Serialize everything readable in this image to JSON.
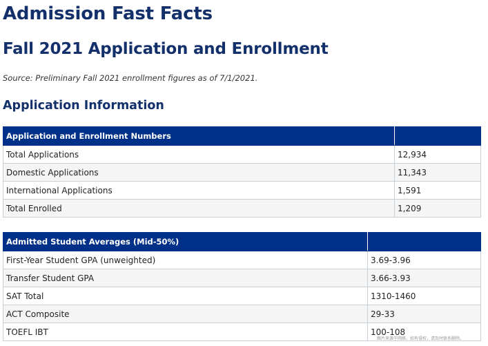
{
  "header": {
    "title": "Admission Fast Facts",
    "subtitle": "Fall 2021 Application and Enrollment",
    "source_note": "Source: Preliminary Fall 2021 enrollment figures as of 7/1/2021.",
    "section_title": "Application Information"
  },
  "colors": {
    "heading": "#13306b",
    "table_header_bg": "#003087",
    "table_header_text": "#ffffff",
    "row_alt_bg": "#f5f5f5",
    "border": "#c8ced6"
  },
  "tables": [
    {
      "header": "Application and Enrollment Numbers",
      "header_value": "",
      "rows": [
        {
          "label": "Total Applications",
          "value": "12,934"
        },
        {
          "label": "Domestic Applications",
          "value": "11,343"
        },
        {
          "label": "International Applications",
          "value": "1,591"
        },
        {
          "label": "Total Enrolled",
          "value": "1,209"
        }
      ]
    },
    {
      "header": "Admitted Student Averages (Mid-50%)",
      "header_value": "",
      "rows": [
        {
          "label": "First-Year Student GPA (unweighted)",
          "value": "3.69-3.96"
        },
        {
          "label": "Transfer Student GPA",
          "value": "3.66-3.93"
        },
        {
          "label": "SAT Total",
          "value": "1310-1460"
        },
        {
          "label": "ACT Composite",
          "value": "29-33"
        },
        {
          "label": "TOEFL IBT",
          "value": "100-108"
        }
      ]
    }
  ],
  "watermark": "图片来源于网络，如有侵权，请及时联系删除。"
}
